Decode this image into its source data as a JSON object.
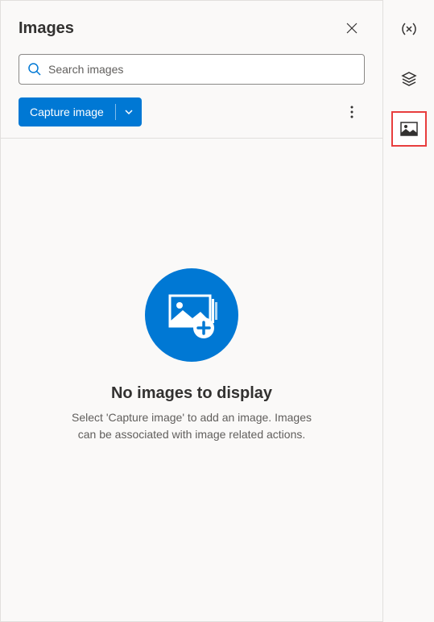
{
  "panel": {
    "title": "Images"
  },
  "search": {
    "placeholder": "Search images"
  },
  "toolbar": {
    "capture_label": "Capture image"
  },
  "empty_state": {
    "title": "No images to display",
    "description": "Select 'Capture image' to add an image. Images can be associated with image related actions."
  },
  "rail": {
    "items": [
      {
        "name": "variables"
      },
      {
        "name": "layers"
      },
      {
        "name": "images"
      }
    ],
    "selected_index": 2
  }
}
